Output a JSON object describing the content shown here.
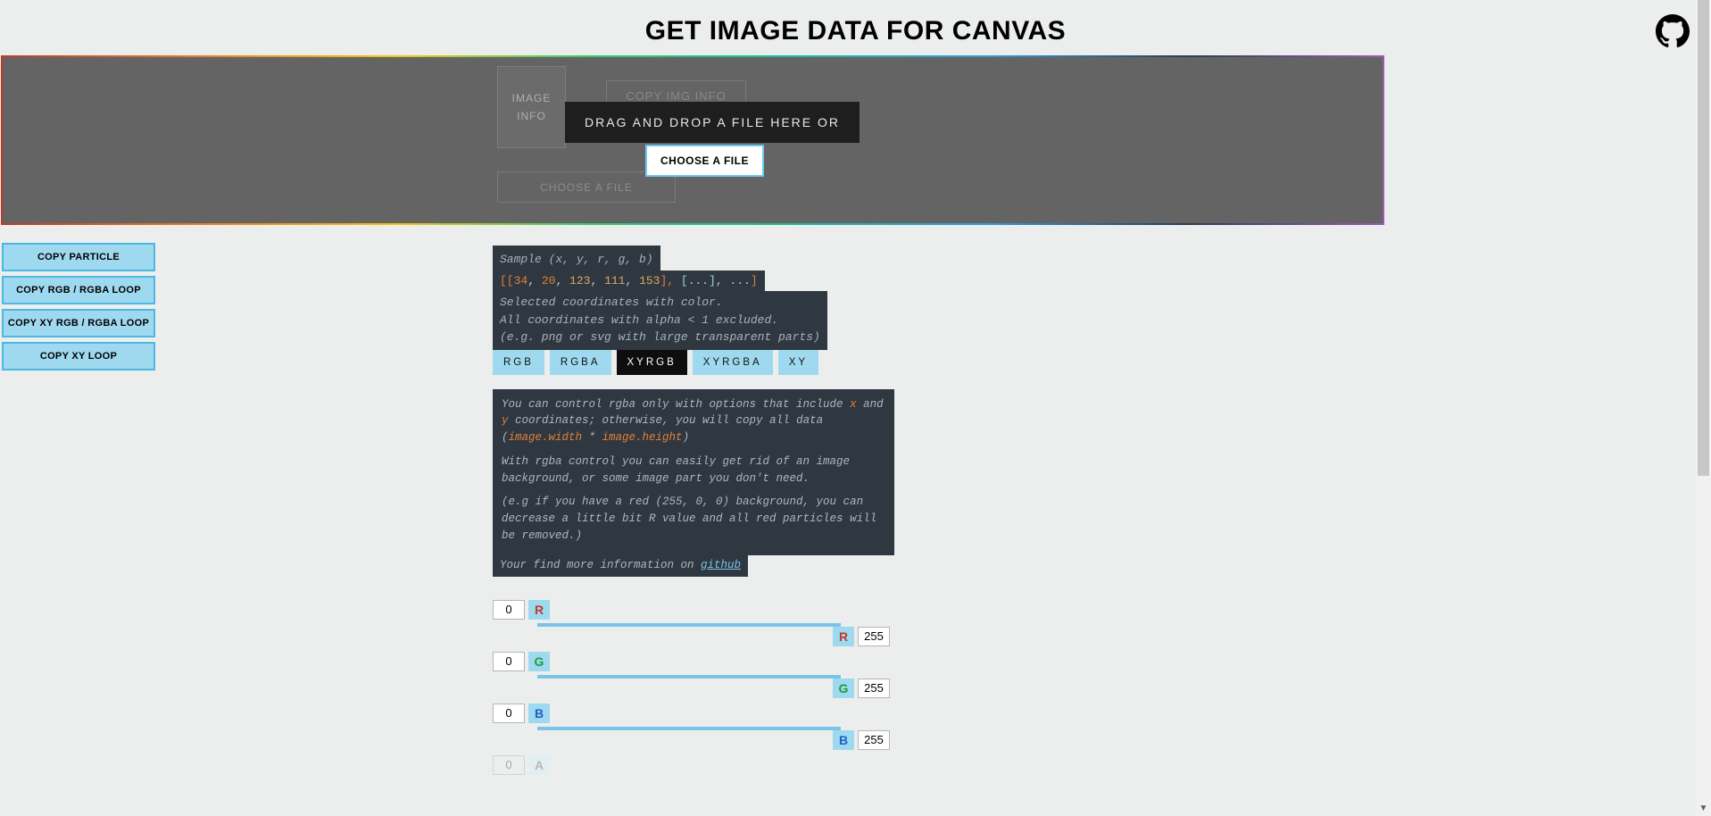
{
  "title": "GET IMAGE DATA FOR CANVAS",
  "ghost": {
    "image_line1": "IMAGE",
    "image_line2": "INFO",
    "copy_img_info": "COPY IMG INFO",
    "choose_file": "CHOOSE A FILE"
  },
  "drop": {
    "text": "DRAG AND DROP A FILE HERE OR",
    "choose_file": "CHOOSE A FILE"
  },
  "sidebar": {
    "copy_particle": "COPY PARTICLE",
    "copy_rgb_rgba": "COPY RGB / RGBA LOOP",
    "copy_xy_rgb_rgba": "COPY XY RGB / RGBA LOOP",
    "copy_xy_loop": "COPY XY LOOP"
  },
  "sample": {
    "comment": "Sample (x, y, r, g, b)",
    "arr_prefix": "[[",
    "v1": "34",
    "c1": ", ",
    "v2": "20",
    "c2": ", ",
    "v3": "123",
    "c3": ", ",
    "v4": "111",
    "c4": ", ",
    "v5": "153",
    "suffix1": "], ",
    "dots1": "[...]",
    "comma2": ", ",
    "dots2": "...",
    "close": "]",
    "note1": "Selected coordinates with color.",
    "note2": "All coordinates with alpha < 1 excluded.",
    "note3": "(e.g. png or svg with large transparent parts)"
  },
  "tabs": {
    "rgb": "RGB",
    "rgba": "RGBA",
    "xyrgb": "XYRGB",
    "xyrgba": "XYRGBA",
    "xy": "XY"
  },
  "info": {
    "p1_a": "You can control rgba only with options that include ",
    "hl_x": "x",
    "p1_b": " and ",
    "hl_y": "y",
    "p1_c": " coordinates; otherwise, you will copy all data (",
    "hl_w": "image.width",
    "p1_d": " * ",
    "hl_h": "image.height",
    "p1_e": ")",
    "p2": "With rgba control you can easily get rid of an image background, or some image part you don't need.",
    "p3": "(e.g if you have a red (255, 0, 0) background, you can decrease a little bit R value and all red particles will be removed.)",
    "link_pre": "Your find more information on ",
    "link_text": "github"
  },
  "sliders": {
    "r": {
      "label": "R",
      "min": "0",
      "max": "255"
    },
    "g": {
      "label": "G",
      "min": "0",
      "max": "255"
    },
    "b": {
      "label": "B",
      "min": "0",
      "max": "255"
    },
    "a": {
      "label": "A",
      "min": "0"
    }
  }
}
